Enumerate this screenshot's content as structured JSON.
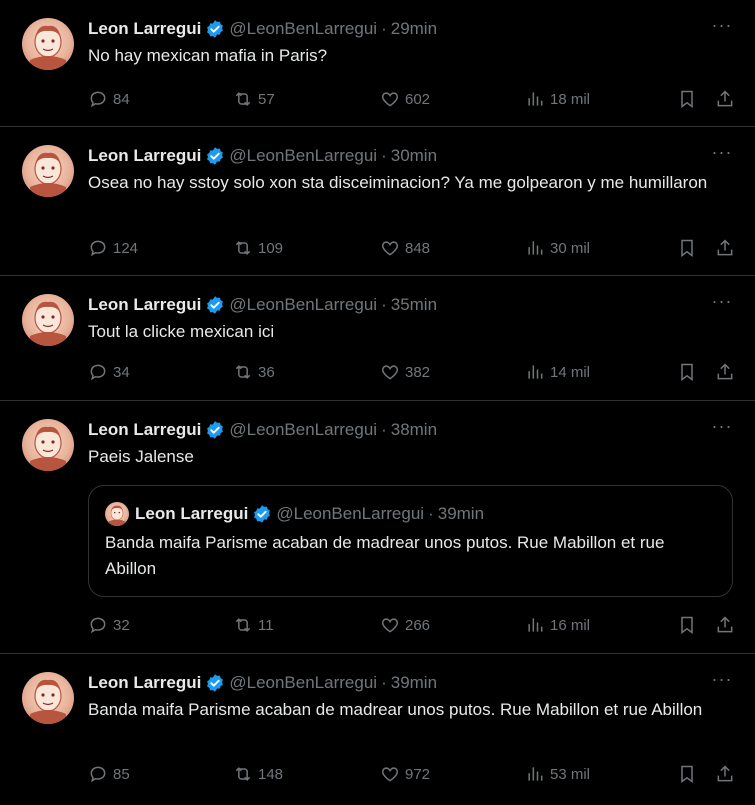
{
  "colors": {
    "background": "#000000",
    "text": "#e7e9ea",
    "muted": "#71767b",
    "divider": "#2f3336",
    "verified": "#1d9bf0"
  },
  "icons": {
    "reply": "reply-icon",
    "retweet": "retweet-icon",
    "like": "heart-icon",
    "views": "views-icon",
    "bookmark": "bookmark-icon",
    "share": "share-icon",
    "more": "more-icon",
    "verified": "verified-badge-icon"
  },
  "tweets": [
    {
      "name": "Leon Larregui",
      "handle": "@LeonBenLarregui",
      "dot": "·",
      "time": "29min",
      "text": "No hay mexican mafia in Paris?",
      "replies": "84",
      "retweets": "57",
      "likes": "602",
      "views": "18 mil",
      "more": "···"
    },
    {
      "name": "Leon Larregui",
      "handle": "@LeonBenLarregui",
      "dot": "·",
      "time": "30min",
      "text": "Osea no hay sstoy solo xon sta disceiminacion? Ya me golpearon y me humillaron",
      "replies": "124",
      "retweets": "109",
      "likes": "848",
      "views": "30 mil",
      "more": "···"
    },
    {
      "name": "Leon Larregui",
      "handle": "@LeonBenLarregui",
      "dot": "·",
      "time": "35min",
      "text": "Tout la clicke  mexican ici",
      "replies": "34",
      "retweets": "36",
      "likes": "382",
      "views": "14 mil",
      "more": "···"
    },
    {
      "name": "Leon Larregui",
      "handle": "@LeonBenLarregui",
      "dot": "·",
      "time": "38min",
      "text": "Paeis Jalense",
      "replies": "32",
      "retweets": "11",
      "likes": "266",
      "views": "16 mil",
      "more": "···",
      "quote": {
        "name": "Leon Larregui",
        "handle": "@LeonBenLarregui",
        "dot": "·",
        "time": "39min",
        "text": "Banda maifa Parisme acaban de madrear unos putos. Rue Mabillon et rue Abillon"
      }
    },
    {
      "name": "Leon Larregui",
      "handle": "@LeonBenLarregui",
      "dot": "·",
      "time": "39min",
      "text": "Banda maifa Parisme acaban de madrear unos putos. Rue Mabillon et rue Abillon",
      "replies": "85",
      "retweets": "148",
      "likes": "972",
      "views": "53 mil",
      "more": "···"
    }
  ]
}
